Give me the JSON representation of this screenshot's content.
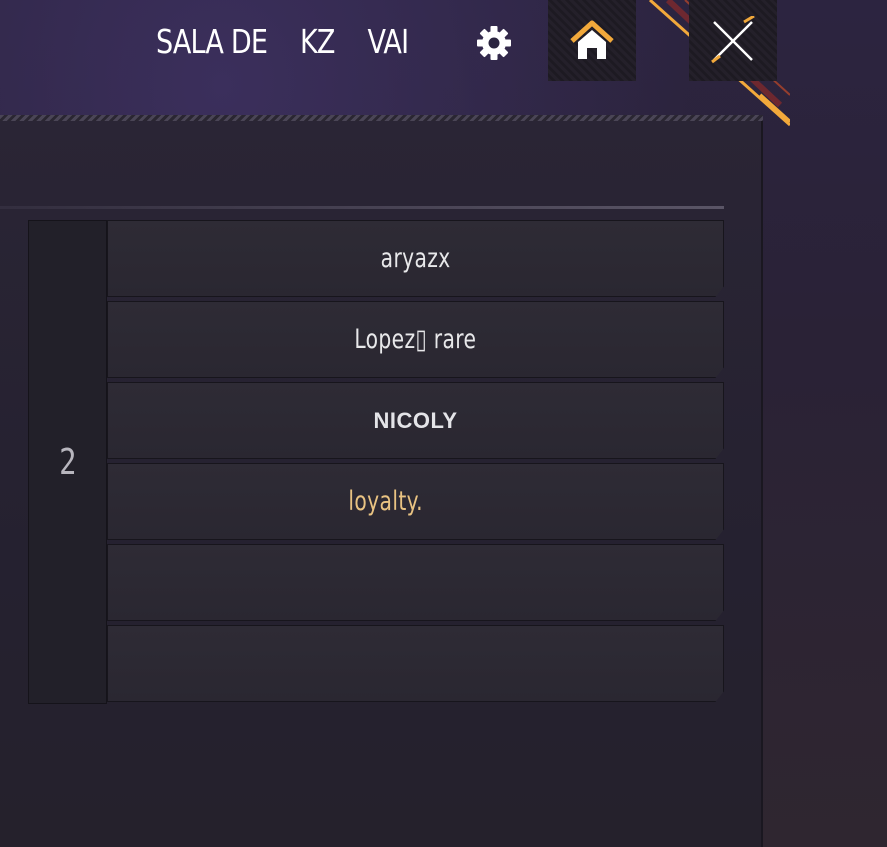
{
  "header": {
    "title_words": [
      "SALA DE",
      "KZ",
      "VAI"
    ],
    "settings_icon": "gear-icon",
    "home_icon": "home-icon",
    "close_icon": "close-icon"
  },
  "team": {
    "number": "2",
    "slots": [
      {
        "name": "aryazx",
        "style": "normal"
      },
      {
        "name": "Lopez▯ rare",
        "style": "normal"
      },
      {
        "name": "NICOLY",
        "style": "plain"
      },
      {
        "name": "loyalty.",
        "style": "gold"
      },
      {
        "name": "",
        "style": "empty"
      },
      {
        "name": "",
        "style": "empty"
      }
    ]
  },
  "colors": {
    "accent_gold": "#e9c382",
    "accent_orange": "#f2a93b"
  }
}
